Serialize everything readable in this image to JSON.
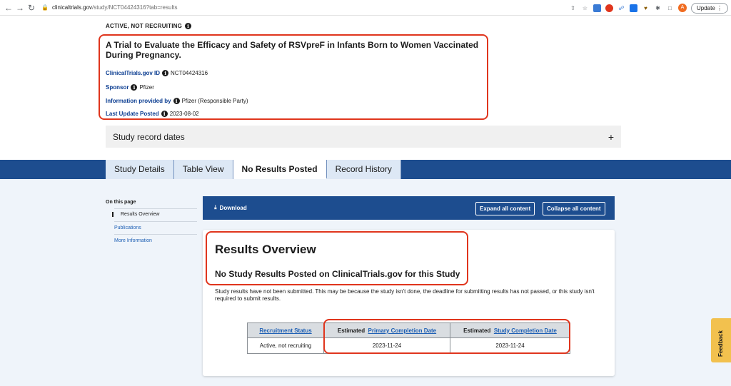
{
  "browser": {
    "url_host": "clinicaltrials.gov",
    "url_path": "/study/NCT04424316?tab=results",
    "update_label": "Update",
    "avatar_letter": "A"
  },
  "study": {
    "status": "ACTIVE, NOT RECRUITING",
    "title": "A Trial to Evaluate the Efficacy and Safety of RSVpreF in Infants Born to Women Vaccinated During Pregnancy.",
    "meta": [
      {
        "label": "ClinicalTrials.gov ID",
        "value": "NCT04424316"
      },
      {
        "label": "Sponsor",
        "value": "Pfizer"
      },
      {
        "label": "Information provided by",
        "value": "Pfizer (Responsible Party)"
      },
      {
        "label": "Last Update Posted",
        "value": "2023-08-02"
      }
    ],
    "record_dates_label": "Study record dates",
    "record_dates_icon": "+"
  },
  "tabs": [
    {
      "label": "Study Details"
    },
    {
      "label": "Table View"
    },
    {
      "label": "No Results Posted"
    },
    {
      "label": "Record History"
    }
  ],
  "sidebar": {
    "title": "On this page",
    "items": [
      "Results Overview",
      "Publications",
      "More Information"
    ]
  },
  "toolbar": {
    "download": "Download",
    "expand": "Expand all content",
    "collapse": "Collapse all content"
  },
  "results": {
    "heading": "Results Overview",
    "subheading": "No Study Results Posted on ClinicalTrials.gov for this Study",
    "description": "Study results have not been submitted. This may be because the study isn't done, the deadline for submitting results has not passed, or this study isn't required to submit results.",
    "table": {
      "col1_header": "Recruitment Status",
      "col2_prefix": "Estimated",
      "col2_link": "Primary Completion Date",
      "col3_prefix": "Estimated",
      "col3_link": "Study Completion Date",
      "row": [
        "Active, not recruiting",
        "2023-11-24",
        "2023-11-24"
      ]
    }
  },
  "feedback_label": "Feedback",
  "colors": {
    "brand_blue": "#1d4d8f",
    "highlight_red": "#e0351d",
    "feedback_yellow": "#f2c14e"
  }
}
